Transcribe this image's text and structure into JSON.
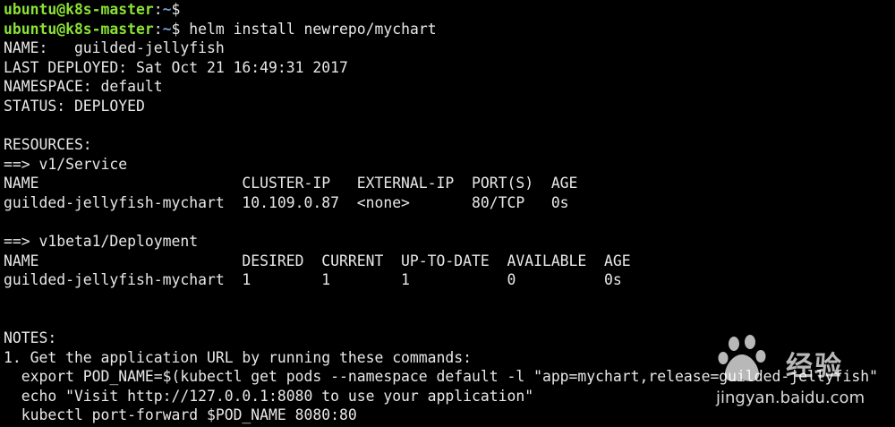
{
  "prompt": {
    "user_host": "ubuntu@k8s-master",
    "separator": ":",
    "path": "~",
    "symbol": "$ "
  },
  "command": "helm install newrepo/mychart",
  "output": [
    "NAME:   guilded-jellyfish",
    "LAST DEPLOYED: Sat Oct 21 16:49:31 2017",
    "NAMESPACE: default",
    "STATUS: DEPLOYED",
    "",
    "RESOURCES:",
    "==> v1/Service",
    "NAME                       CLUSTER-IP   EXTERNAL-IP  PORT(S)  AGE",
    "guilded-jellyfish-mychart  10.109.0.87  <none>       80/TCP   0s",
    "",
    "==> v1beta1/Deployment",
    "NAME                       DESIRED  CURRENT  UP-TO-DATE  AVAILABLE  AGE",
    "guilded-jellyfish-mychart  1        1        1           0          0s",
    "",
    "",
    "NOTES:",
    "1. Get the application URL by running these commands:",
    "  export POD_NAME=$(kubectl get pods --namespace default -l \"app=mychart,release=guilded-jellyfish\"",
    "  echo \"Visit http://127.0.0.1:8080 to use your application\"",
    "  kubectl port-forward $POD_NAME 8080:80"
  ],
  "watermark": {
    "brand": "经验",
    "url": "jingyan.baidu.com",
    "icon": "baidu-paw-icon"
  },
  "colors": {
    "background": "#000000",
    "text": "#e8e8e8",
    "prompt_user": "#8ae234",
    "prompt_path": "#729fcf"
  }
}
